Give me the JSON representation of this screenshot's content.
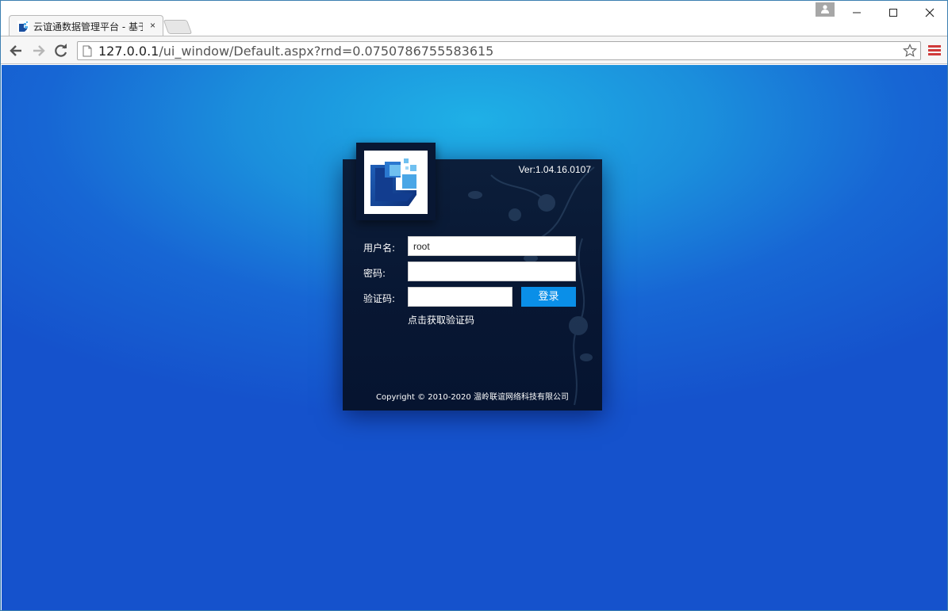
{
  "browser": {
    "tab_title": "云谊通数据管理平台 - 基于",
    "tab_close": "×",
    "url_host": "127.0.0.1",
    "url_path": "/ui_window/Default.aspx?rnd=0.0750786755583615"
  },
  "login": {
    "version": "Ver:1.04.16.0107",
    "username_label": "用户名:",
    "username_value": "root",
    "password_label": "密码:",
    "password_value": "",
    "captcha_label": "验证码:",
    "captcha_value": "",
    "login_button": "登录",
    "get_captcha_link": "点击获取验证码",
    "copyright": "Copyright © 2010-2020 温岭联谊网络科技有限公司"
  },
  "colors": {
    "accent_button": "#0a8fe8",
    "panel_bg": "#081733",
    "page_bg": "#1766d4",
    "menu_icon": "#d03a3a"
  }
}
